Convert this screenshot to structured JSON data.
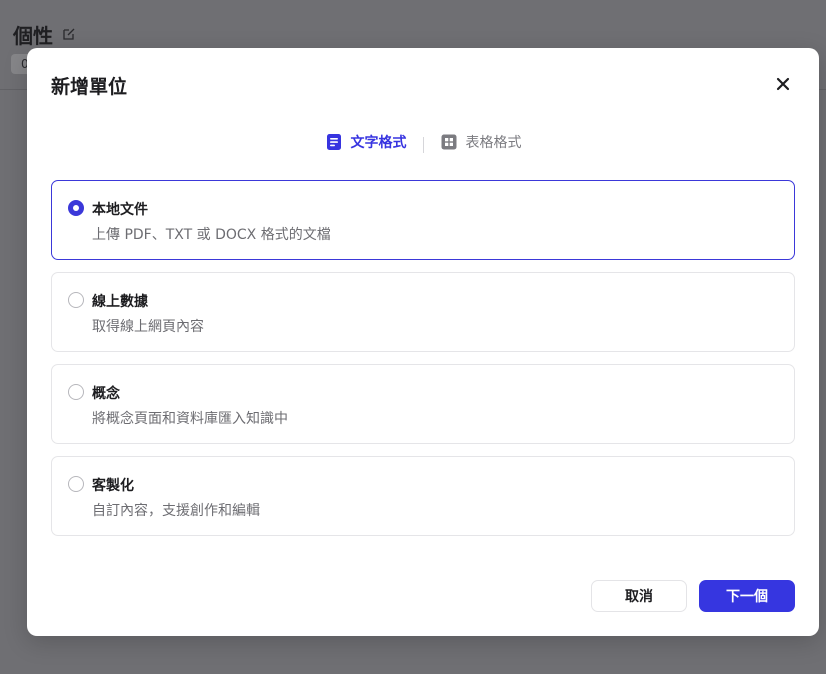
{
  "background": {
    "title": "個性",
    "chip_text": "0"
  },
  "modal": {
    "title": "新增單位",
    "tabs": [
      {
        "label": "文字格式",
        "icon": "document-icon",
        "active": true
      },
      {
        "label": "表格格式",
        "icon": "table-icon",
        "active": false
      }
    ],
    "options": [
      {
        "title": "本地文件",
        "description": "上傳 PDF、TXT 或 DOCX 格式的文檔",
        "selected": true
      },
      {
        "title": "線上數據",
        "description": "取得線上網頁內容",
        "selected": false
      },
      {
        "title": "概念",
        "description": "將概念頁面和資料庫匯入知識中",
        "selected": false
      },
      {
        "title": "客製化",
        "description": "自訂內容，支援創作和編輯",
        "selected": false
      }
    ],
    "buttons": {
      "cancel": "取消",
      "next": "下一個"
    }
  },
  "colors": {
    "accent": "#3636e0",
    "overlay": "#6f6f73"
  }
}
